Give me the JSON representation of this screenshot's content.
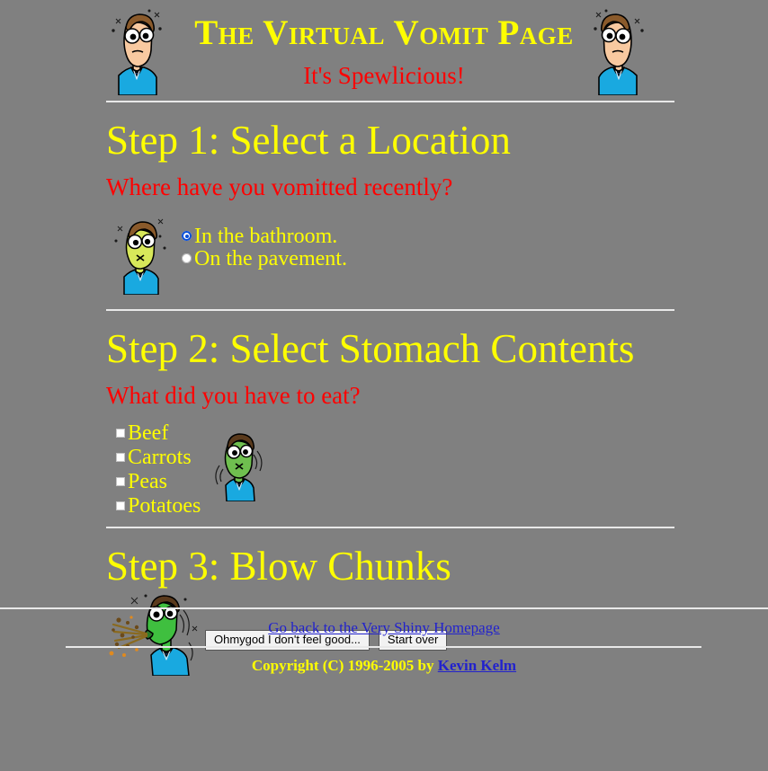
{
  "page": {
    "background_color": "#808080",
    "heading_color": "#ffff00",
    "question_color": "#ff0000",
    "link_color": "#2222cc"
  },
  "header": {
    "title": "The Virtual Vomit Page",
    "subtitle": "It's Spewlicious!",
    "left_figure_name": "worried-man-illustration",
    "right_figure_name": "worried-man-illustration-mirrored"
  },
  "step1": {
    "title": "Step 1: Select a Location",
    "question": "Where have you vomitted recently?",
    "figure_name": "queasy-man-illustration",
    "options": [
      {
        "label": "In the bathroom.",
        "selected": true
      },
      {
        "label": "On the pavement.",
        "selected": false
      }
    ]
  },
  "step2": {
    "title": "Step 2: Select Stomach Contents",
    "question": "What did you have to eat?",
    "figure_name": "green-shaking-man-illustration",
    "items": [
      {
        "label": "Beef",
        "checked": false
      },
      {
        "label": "Carrots",
        "checked": false
      },
      {
        "label": "Peas",
        "checked": false
      },
      {
        "label": "Potatoes",
        "checked": false
      }
    ]
  },
  "step3": {
    "title": "Step 3: Blow Chunks",
    "figure_name": "vomiting-man-illustration",
    "submit_label": "Ohmygod I don't feel good...",
    "reset_label": "Start over"
  },
  "footer": {
    "home_link": "Go back to the Very Shiny Homepage",
    "copyright_prefix": "Copyright (C) 1996-2005 by ",
    "author_link": "Kevin Kelm"
  }
}
